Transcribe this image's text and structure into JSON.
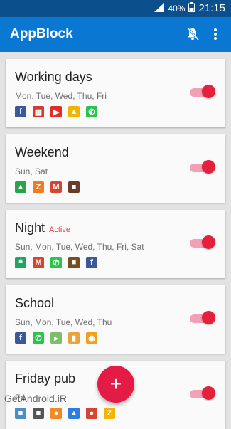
{
  "statusbar": {
    "battery": "40%",
    "time": "21:15"
  },
  "appbar": {
    "title": "AppBlock"
  },
  "profiles": [
    {
      "name": "Working days",
      "active": "",
      "days": "Mon, Tue, Wed, Thu, Fri",
      "apps": [
        {
          "icon": "facebook-icon",
          "color": "#3b5998",
          "glyph": "f"
        },
        {
          "icon": "video-icon",
          "color": "#d63a2d",
          "glyph": "▦"
        },
        {
          "icon": "youtube-icon",
          "color": "#e52d27",
          "glyph": "▶"
        },
        {
          "icon": "drive-icon",
          "color": "#f3b400",
          "glyph": "▲"
        },
        {
          "icon": "whatsapp-icon",
          "color": "#28c44b",
          "glyph": "✆"
        }
      ]
    },
    {
      "name": "Weekend",
      "active": "",
      "days": "Sun, Sat",
      "apps": [
        {
          "icon": "drive-icon",
          "color": "#2ba24c",
          "glyph": "▲"
        },
        {
          "icon": "slides-icon",
          "color": "#f47a1f",
          "glyph": "Z"
        },
        {
          "icon": "gmail-icon",
          "color": "#d6452f",
          "glyph": "M"
        },
        {
          "icon": "game-icon",
          "color": "#6b3a2a",
          "glyph": "■"
        }
      ]
    },
    {
      "name": "Night",
      "active": "Active",
      "days": "Sun, Mon, Tue, Wed, Thu, Fri, Sat",
      "apps": [
        {
          "icon": "hangouts-icon",
          "color": "#1fa463",
          "glyph": "❝"
        },
        {
          "icon": "gmail-icon",
          "color": "#d6452f",
          "glyph": "M"
        },
        {
          "icon": "whatsapp-icon",
          "color": "#28c44b",
          "glyph": "✆"
        },
        {
          "icon": "game-icon",
          "color": "#7a4d1f",
          "glyph": "■"
        },
        {
          "icon": "facebook-icon",
          "color": "#3b5998",
          "glyph": "f"
        }
      ]
    },
    {
      "name": "School",
      "active": "",
      "days": "Sun, Mon, Tue, Wed, Thu",
      "apps": [
        {
          "icon": "facebook-icon",
          "color": "#3b5998",
          "glyph": "f"
        },
        {
          "icon": "whatsapp-icon",
          "color": "#28c44b",
          "glyph": "✆"
        },
        {
          "icon": "store-icon",
          "color": "#7bbf6a",
          "glyph": "▸"
        },
        {
          "icon": "bottle-icon",
          "color": "#e8a33b",
          "glyph": "▮"
        },
        {
          "icon": "chrome-icon",
          "color": "#f0a01d",
          "glyph": "◉"
        }
      ]
    },
    {
      "name": "Friday pub",
      "active": "",
      "days": "Fri",
      "apps": [
        {
          "icon": "app-icon",
          "color": "#4a8ec8",
          "glyph": "■"
        },
        {
          "icon": "game-icon",
          "color": "#555555",
          "glyph": "■"
        },
        {
          "icon": "app-icon",
          "color": "#f08a24",
          "glyph": "●"
        },
        {
          "icon": "drive-icon",
          "color": "#2b7de0",
          "glyph": "▲"
        },
        {
          "icon": "app-icon",
          "color": "#d6452f",
          "glyph": "●"
        },
        {
          "icon": "slides-icon",
          "color": "#f4b400",
          "glyph": "Z"
        }
      ]
    }
  ],
  "fab": {
    "label": "+"
  },
  "watermark": "GetAndroid.iR"
}
